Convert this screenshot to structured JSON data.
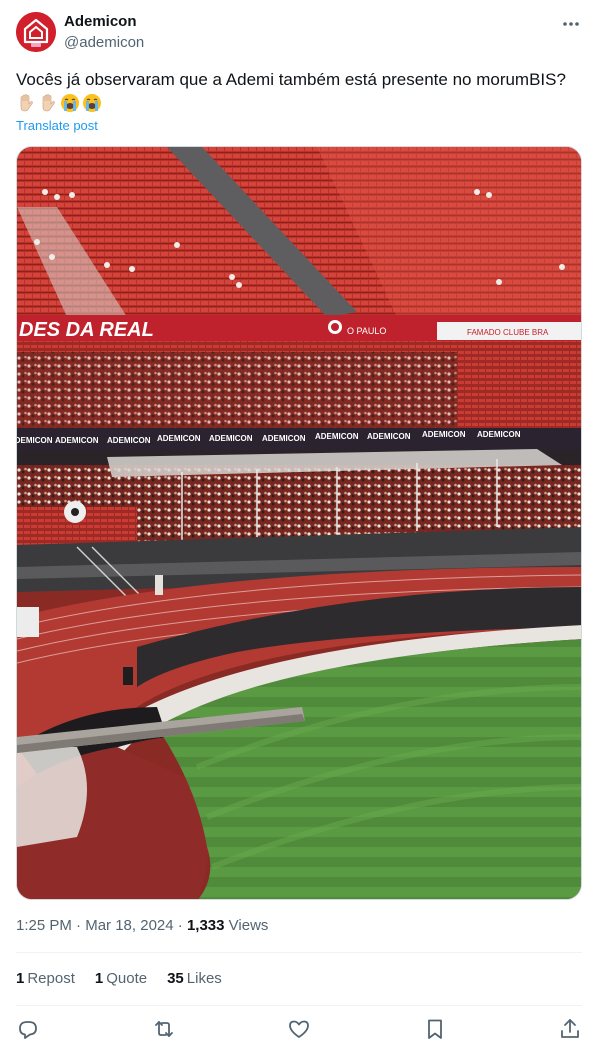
{
  "author": {
    "display_name": "Ademicon",
    "handle": "@ademicon"
  },
  "post": {
    "text": "Vocês já observaram que a Ademi também está presente no morumBIS?",
    "emojis": [
      "raised-hand-emoji",
      "raised-hand-emoji",
      "loudly-crying-emoji",
      "loudly-crying-emoji"
    ],
    "translate_label": "Translate post"
  },
  "photo": {
    "banner_top": "DES DA REAL",
    "banner_small": "O PAULO",
    "banner_right": "FAMADO CLUBE BRA",
    "ad_board": [
      "ADEMICON",
      "ADEMICON",
      "ADEMICON",
      "ADEMICON",
      "ADEMICON",
      "ADEMICON",
      "ADEMICON",
      "ADEMICON",
      "ADEMICON",
      "ADEMICON"
    ]
  },
  "meta": {
    "time": "1:25 PM",
    "separator": "·",
    "date": "Mar 18, 2024",
    "views_count": "1,333",
    "views_label": "Views"
  },
  "stats": {
    "reposts_count": "1",
    "reposts_label": "Repost",
    "quotes_count": "1",
    "quotes_label": "Quote",
    "likes_count": "35",
    "likes_label": "Likes"
  },
  "colors": {
    "link": "#1d9bf0",
    "secondary_text": "#536471",
    "brand_red": "#d1202b"
  }
}
